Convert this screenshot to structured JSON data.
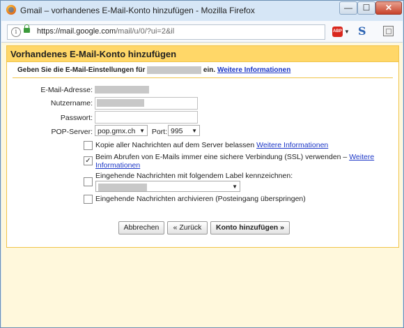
{
  "window": {
    "title": "Gmail – vorhandenes E-Mail-Konto hinzufügen - Mozilla Firefox",
    "minimize": "—",
    "maximize": "☐",
    "close": "✕"
  },
  "navbar": {
    "url_host": "https://mail.google.com",
    "url_path": "/mail/u/0/?ui=2&il",
    "icons": [
      "info-icon",
      "lock-icon",
      "adblock-plus-icon",
      "s-extension-icon",
      "page-icon"
    ],
    "abp_label": "ABP"
  },
  "form": {
    "heading": "Vorhandenes E-Mail-Konto hinzufügen",
    "intro_before": "Geben Sie die E-Mail-Einstellungen für",
    "intro_after": "ein.",
    "intro_link": "Weitere Informationen",
    "email_label": "E-Mail-Adresse:",
    "username_label": "Nutzername:",
    "password_label": "Passwort:",
    "pop_label": "POP-Server:",
    "pop_value": "pop.gmx.ch",
    "port_label": "Port:",
    "port_value": "995",
    "options": [
      {
        "label": "Kopie aller Nachrichten auf dem Server belassen",
        "link": "Weitere Informationen",
        "checked": false
      },
      {
        "label": "Beim Abrufen von E-Mails immer eine sichere Verbindung (SSL) verwenden –",
        "link_line1": "Weitere",
        "link_line2": "Informationen",
        "checked": true
      },
      {
        "label": "Eingehende Nachrichten mit folgendem Label kennzeichnen:",
        "checked": false
      },
      {
        "label": "Eingehende Nachrichten archivieren (Posteingang überspringen)",
        "checked": false
      }
    ],
    "check_mark": "✓",
    "buttons": {
      "cancel": "Abbrechen",
      "back": "« Zurück",
      "add": "Konto hinzufügen »"
    },
    "colors": {
      "header_bg": "#ffd768",
      "border": "#f0c44a",
      "page_bg": "#fff8dc",
      "link": "#1a35c6"
    }
  }
}
